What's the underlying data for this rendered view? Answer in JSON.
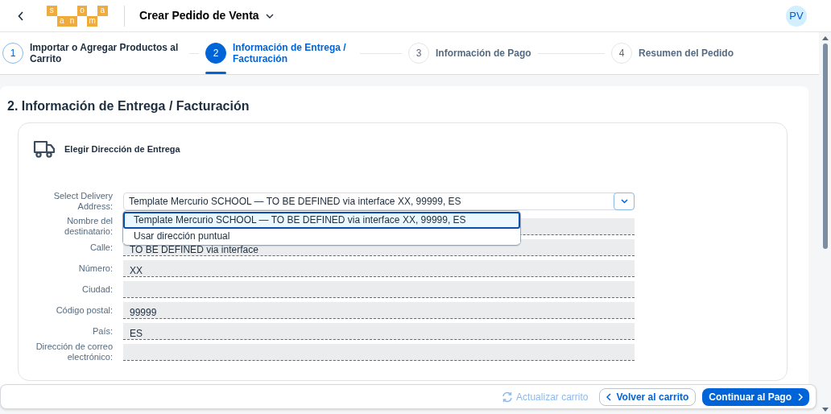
{
  "header": {
    "logo": [
      {
        "letter": "s",
        "raised": true
      },
      {
        "letter": "a",
        "raised": false
      },
      {
        "letter": "n",
        "raised": false
      },
      {
        "letter": "o",
        "raised": true
      },
      {
        "letter": "m",
        "raised": false
      },
      {
        "letter": "a",
        "raised": true
      }
    ],
    "title": "Crear Pedido de Venta",
    "avatar": "PV"
  },
  "steps": [
    {
      "number": "1",
      "label": "Importar o Agregar Productos al Carrito",
      "completed": true,
      "selected": false
    },
    {
      "number": "2",
      "label": "Información de Entrega / Facturación",
      "completed": false,
      "selected": true
    },
    {
      "number": "3",
      "label": "Información de Pago",
      "completed": false,
      "selected": false
    },
    {
      "number": "4",
      "label": "Resumen del Pedido",
      "completed": false,
      "selected": false
    }
  ],
  "section_title": "2. Información de Entrega / Facturación",
  "card": {
    "title": "Elegir Dirección de Entrega",
    "select": {
      "label": "Select Delivery Address:",
      "value": "Template Mercurio SCHOOL — TO BE DEFINED via interface XX, 99999, ES",
      "expanded": true,
      "options": [
        {
          "label": "Template Mercurio SCHOOL — TO BE DEFINED via interface XX, 99999, ES",
          "selected": true
        },
        {
          "label": "Usar dirección puntual",
          "selected": false
        }
      ]
    },
    "fields": [
      {
        "label": "Nombre del destinatario:"
      },
      {
        "label": "Calle:",
        "value": "TO BE DEFINED via interface"
      },
      {
        "label": "Número:",
        "value": "XX"
      },
      {
        "label": "Ciudad:"
      },
      {
        "label": "Código postal:",
        "value": "99999"
      },
      {
        "label": "País:",
        "value": "ES"
      },
      {
        "label": "Dirección de correo electrónico:"
      }
    ]
  },
  "footer": {
    "refresh": {
      "label": "Actualizar carrito",
      "disabled": true
    },
    "back": "Volver al carrito",
    "next": "Continuar al Pago"
  }
}
